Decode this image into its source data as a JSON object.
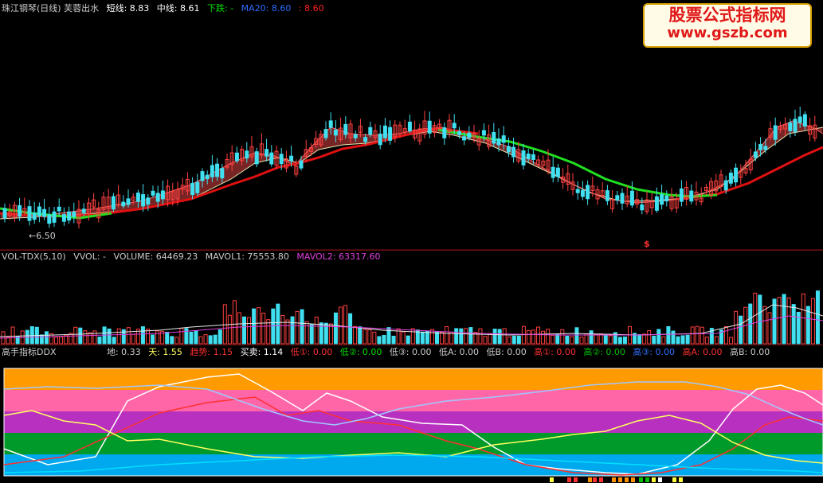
{
  "main": {
    "title": "珠江钢琴(日线) 芙蓉出水",
    "items": [
      {
        "label": "短线: 8.83",
        "color": "#ffffff"
      },
      {
        "label": "中线: 8.61",
        "color": "#ffffff"
      },
      {
        "label": "下跌: -",
        "color": "#00e000"
      },
      {
        "label": "MA20: 8.60",
        "color": "#2a6cff"
      },
      {
        "label": ": 8.60",
        "color": "#ff2020"
      }
    ],
    "low_label": "6.50",
    "marker": "$"
  },
  "vol": {
    "title": "VOL-TDX(5,10)",
    "items": [
      {
        "label": "VVOL: -",
        "color": "#cccccc"
      },
      {
        "label": "VOLUME: 64469.23",
        "color": "#cccccc"
      },
      {
        "label": "MAVOL1: 75553.80",
        "color": "#cccccc"
      },
      {
        "label": "MAVOL2: 63317.60",
        "color": "#e040e0"
      }
    ]
  },
  "ddx": {
    "title": "高手指标DDX",
    "items": [
      {
        "label": "地: 0.33",
        "color": "#cccccc"
      },
      {
        "label": "天: 1.55",
        "color": "#ffff60"
      },
      {
        "label": "趋势: 1.15",
        "color": "#ff3030"
      },
      {
        "label": "买卖: 1.14",
        "color": "#ffffff"
      },
      {
        "label": "低①: 0.00",
        "color": "#ff3030"
      },
      {
        "label": "低②: 0.00",
        "color": "#00e000"
      },
      {
        "label": "低③: 0.00",
        "color": "#cccccc"
      },
      {
        "label": "低A: 0.00",
        "color": "#cccccc"
      },
      {
        "label": "低B: 0.00",
        "color": "#cccccc"
      },
      {
        "label": "高①: 0.00",
        "color": "#ff3030"
      },
      {
        "label": "高②: 0.00",
        "color": "#00c000"
      },
      {
        "label": "高③: 0.00",
        "color": "#3070ff"
      },
      {
        "label": "高A: 0.00",
        "color": "#ff3030"
      },
      {
        "label": "高B: 0.00",
        "color": "#cccccc"
      }
    ],
    "bands": [
      "#ff9a00",
      "#ff66a8",
      "#b830c0",
      "#009a2a",
      "#00a8ee"
    ]
  },
  "watermark": {
    "line1": "股票公式指标网",
    "line2": "www.gszb.com"
  }
}
